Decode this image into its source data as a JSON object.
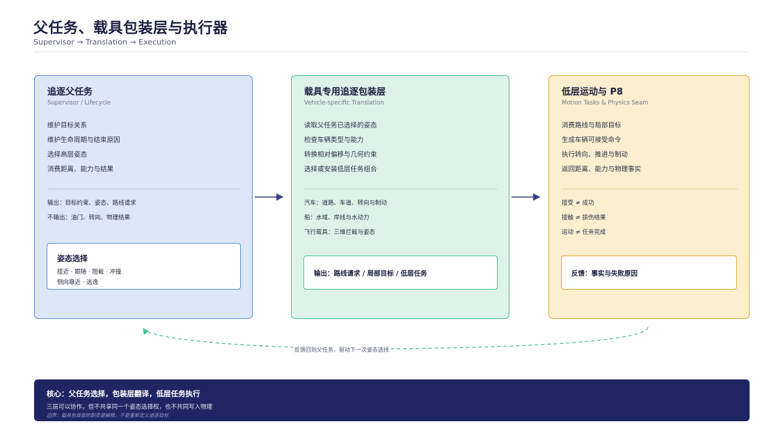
{
  "header": {
    "title": "父任务、载具包装层与执行器",
    "subtitle": "Supervisor → Translation → Execution"
  },
  "panels": [
    {
      "title": "追逐父任务",
      "subtitle": "Supervisor / Lifecycle",
      "items": [
        "维护目标关系",
        "维护生命周期与结束原因",
        "选择高层姿态",
        "消费距离、能力与结果"
      ],
      "notes": [
        "输出：目标约束、姿态、路线请求",
        "不输出：油门、转向、物理结果"
      ],
      "box": {
        "title": "姿态选择",
        "lines": [
          "接近 · 跟随 · 阻截 · 冲撞",
          "侧向靠近 · 逃逸"
        ]
      }
    },
    {
      "title": "载具专用追逐包装层",
      "subtitle": "Vehicle-specific Translation",
      "items": [
        "读取父任务已选择的姿态",
        "检查车辆类型与能力",
        "转换相对偏移与几何约束",
        "选择或安装低层任务组合"
      ],
      "notes": [
        "汽车：道路、车道、转向与制动",
        "船：水域、岸线与水动力",
        "飞行载具：三维拦截与姿态"
      ],
      "box": {
        "text": "输出：路线请求 / 局部目标 / 低层任务"
      }
    },
    {
      "title": "低层运动与 P8",
      "subtitle": "Motion Tasks & Physics Seam",
      "items": [
        "消费路线与局部目标",
        "生成车辆可接受命令",
        "执行转向、推进与制动",
        "返回距离、能力与物理事实"
      ],
      "notes": [
        "接受 ≠ 成功",
        "接触 ≠ 损伤结果",
        "运动 ≠ 任务完成"
      ],
      "box": {
        "text": "反馈：事实与失败原因"
      }
    }
  ],
  "loop": {
    "label": "反馈回到父任务，驱动下一次姿态选择"
  },
  "footer": {
    "title": "核心：父任务选择，包装层翻译，低层任务执行",
    "line": "三层可以协作，但不共享同一个姿态选择权，也不共同写入物理",
    "note": "边界：载具包装层的职责是解释，不是重新定义追逐目标"
  },
  "colors": {
    "panel_1_border": "#5c93d6",
    "panel_2_border": "#4cc08f",
    "panel_3_border": "#e0ac33",
    "arrow": "#3a4280",
    "loop": "#4cc08f",
    "footer_bg": "#1e2562"
  }
}
